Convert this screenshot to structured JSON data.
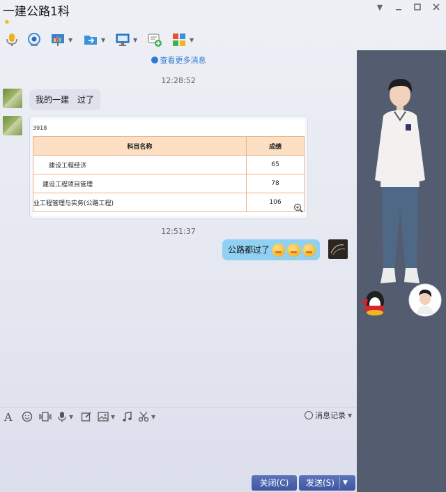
{
  "window": {
    "title": "一建公路1科"
  },
  "toolbar": {
    "items": [
      "voice-call",
      "video-call",
      "screen-share",
      "send-file",
      "remote-desktop",
      "create-discussion-group",
      "apps"
    ]
  },
  "chat": {
    "more_messages_link": "查看更多消息",
    "messages": [
      {
        "timestamp": "12:28:52",
        "from": "other",
        "text": "我的一建　过了"
      },
      {
        "from": "other",
        "card": {
          "code_fragment": "3918",
          "table_headers": [
            "科目名称",
            "成绩"
          ],
          "table_rows": [
            [
              "建设工程经济",
              "65"
            ],
            [
              "建设工程项目管理",
              "78"
            ],
            [
              "业工程管理与实务(公路工程)",
              "106"
            ]
          ]
        }
      },
      {
        "timestamp": "12:51:37",
        "from": "self",
        "text": "公路都过了",
        "emoji_count": 3
      }
    ]
  },
  "input_toolbar": {
    "history_label": "消息记录"
  },
  "buttons": {
    "close_label": "关闭(C)",
    "send_label": "发送(S)"
  },
  "colors": {
    "accent_blue": "#2f7ad6",
    "button_blue": "#4a62aa",
    "outgoing_bubble": "#8fd0f3",
    "incoming_bubble": "#dfe2ea",
    "table_header": "#fde0c3",
    "side_panel": "#545c70"
  }
}
